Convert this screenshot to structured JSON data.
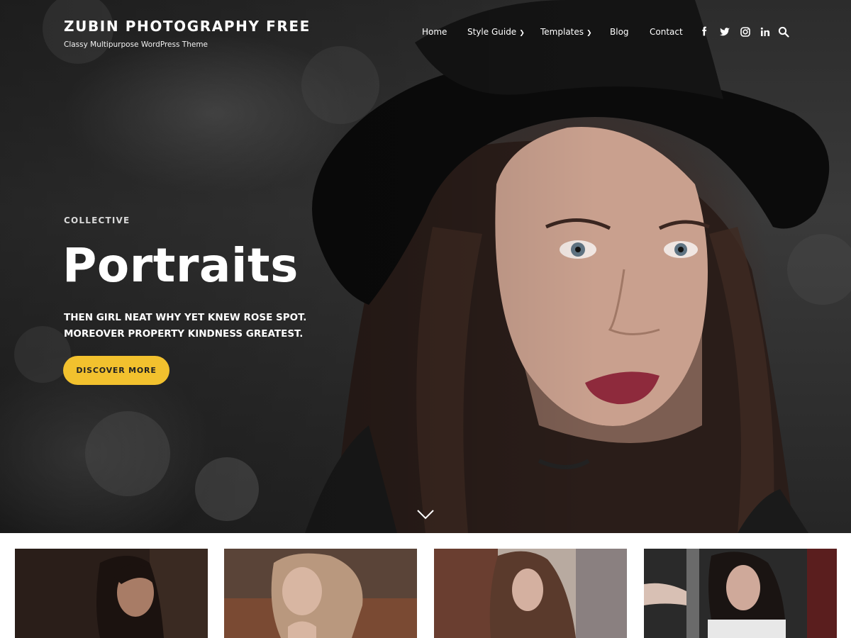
{
  "site": {
    "title": "ZUBIN PHOTOGRAPHY FREE",
    "tagline": "Classy Multipurpose WordPress Theme"
  },
  "nav": {
    "items": [
      {
        "label": "Home"
      },
      {
        "label": "Style Guide",
        "has_dropdown": true
      },
      {
        "label": "Templates",
        "has_dropdown": true
      },
      {
        "label": "Blog"
      },
      {
        "label": "Contact"
      }
    ]
  },
  "social": {
    "icons": [
      "facebook-icon",
      "twitter-icon",
      "instagram-icon",
      "linkedin-icon",
      "search-icon"
    ]
  },
  "hero": {
    "eyebrow": "COLLECTIVE",
    "title": "Portraits",
    "text": "THEN GIRL NEAT WHY YET KNEW ROSE SPOT. MOREOVER PROPERTY KINDNESS GREATEST.",
    "button_label": "DISCOVER MORE",
    "scroll_icon": "chevron-down-icon"
  },
  "gallery": {
    "items": [
      {
        "image": "portrait-thumbnail-1"
      },
      {
        "image": "portrait-thumbnail-2"
      },
      {
        "image": "portrait-thumbnail-3"
      },
      {
        "image": "portrait-thumbnail-4"
      }
    ]
  },
  "colors": {
    "accent": "#f2c12e",
    "text_light": "#ffffff",
    "hero_dark": "#2c2c2c"
  }
}
